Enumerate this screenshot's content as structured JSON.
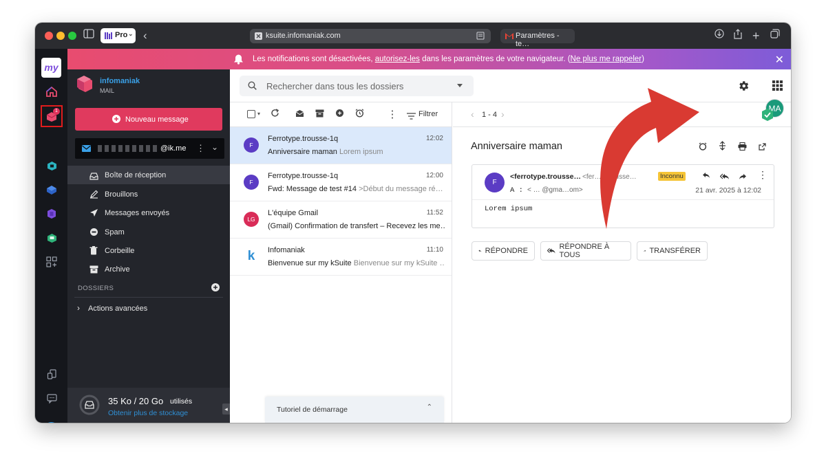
{
  "browser": {
    "workspace_label": "Pro",
    "url": "ksuite.infomaniak.com",
    "tab_title": "Paramètres - te…"
  },
  "notification": {
    "text_before": "Les notifications sont désactivées, ",
    "link_allow": "autorisez-les",
    "text_middle": " dans les paramètres de votre navigateur. (",
    "link_dismiss": "Ne plus me rappeler",
    "text_end": ")"
  },
  "rail": {
    "logo": "my",
    "mail_badge": "1"
  },
  "sidebar": {
    "brand": "infomaniak",
    "product": "MAIL",
    "new_message": "Nouveau message",
    "account_email": "@ik.me",
    "folders": [
      {
        "label": "Boîte de réception",
        "icon": "inbox-icon"
      },
      {
        "label": "Brouillons",
        "icon": "draft-icon"
      },
      {
        "label": "Messages envoyés",
        "icon": "send-icon"
      },
      {
        "label": "Spam",
        "icon": "spam-icon"
      },
      {
        "label": "Corbeille",
        "icon": "trash-icon"
      },
      {
        "label": "Archive",
        "icon": "archive-icon"
      }
    ],
    "folders_header": "DOSSIERS",
    "advanced": "Actions avancées",
    "storage_used": "35 Ko / 20 Go",
    "storage_suffix": "utilisés",
    "storage_link": "Obtenir plus de stockage"
  },
  "search": {
    "placeholder": "Rechercher dans tous les dossiers"
  },
  "header": {
    "avatar_initials": "MA"
  },
  "toolbar": {
    "filter_label": "Filtrer",
    "pagination": "1 - 4"
  },
  "messages": [
    {
      "initial": "F",
      "from": "Ferrotype.trousse-1q",
      "time": "12:02",
      "subject": "Anniversaire maman",
      "preview": "Lorem ipsum",
      "color": "#5b3cc4",
      "selected": true
    },
    {
      "initial": "F",
      "from": "Ferrotype.trousse-1q",
      "time": "12:00",
      "subject": "Fwd: Message de test #14",
      "preview": ">Début du message ré…",
      "color": "#5b3cc4",
      "selected": false
    },
    {
      "initial": "LG",
      "from": "L'équipe Gmail",
      "time": "11:52",
      "subject": "(Gmail) Confirmation de transfert – Recevez les me…",
      "preview": "",
      "color": "#d92c58",
      "selected": false
    },
    {
      "initial": "k",
      "from": "Infomaniak",
      "time": "11:10",
      "subject": "Bienvenue sur my kSuite",
      "preview": "Bienvenue sur my kSuite …",
      "color": "#ffffff",
      "selected": false
    }
  ],
  "tutorial": {
    "label": "Tutoriel de démarrage"
  },
  "reader": {
    "subject": "Anniversaire maman",
    "sender_initial": "F",
    "sender_name": "<ferrotype.trousse…",
    "sender_email": "<fer…e.trousse…",
    "unknown_badge": "Inconnu",
    "to_label": "A :",
    "to_value": "<  …  @gma…om>",
    "date": "21 avr. 2025 à 12:02",
    "body": "Lorem ipsum",
    "reply": "RÉPONDRE",
    "reply_all": "RÉPONDRE À TOUS",
    "forward": "TRANSFÉRER"
  },
  "colors": {
    "accent": "#e03a5e",
    "link": "#2f8fd4",
    "arrow": "#d93a32",
    "avatar_header": "#1a9a7a"
  }
}
